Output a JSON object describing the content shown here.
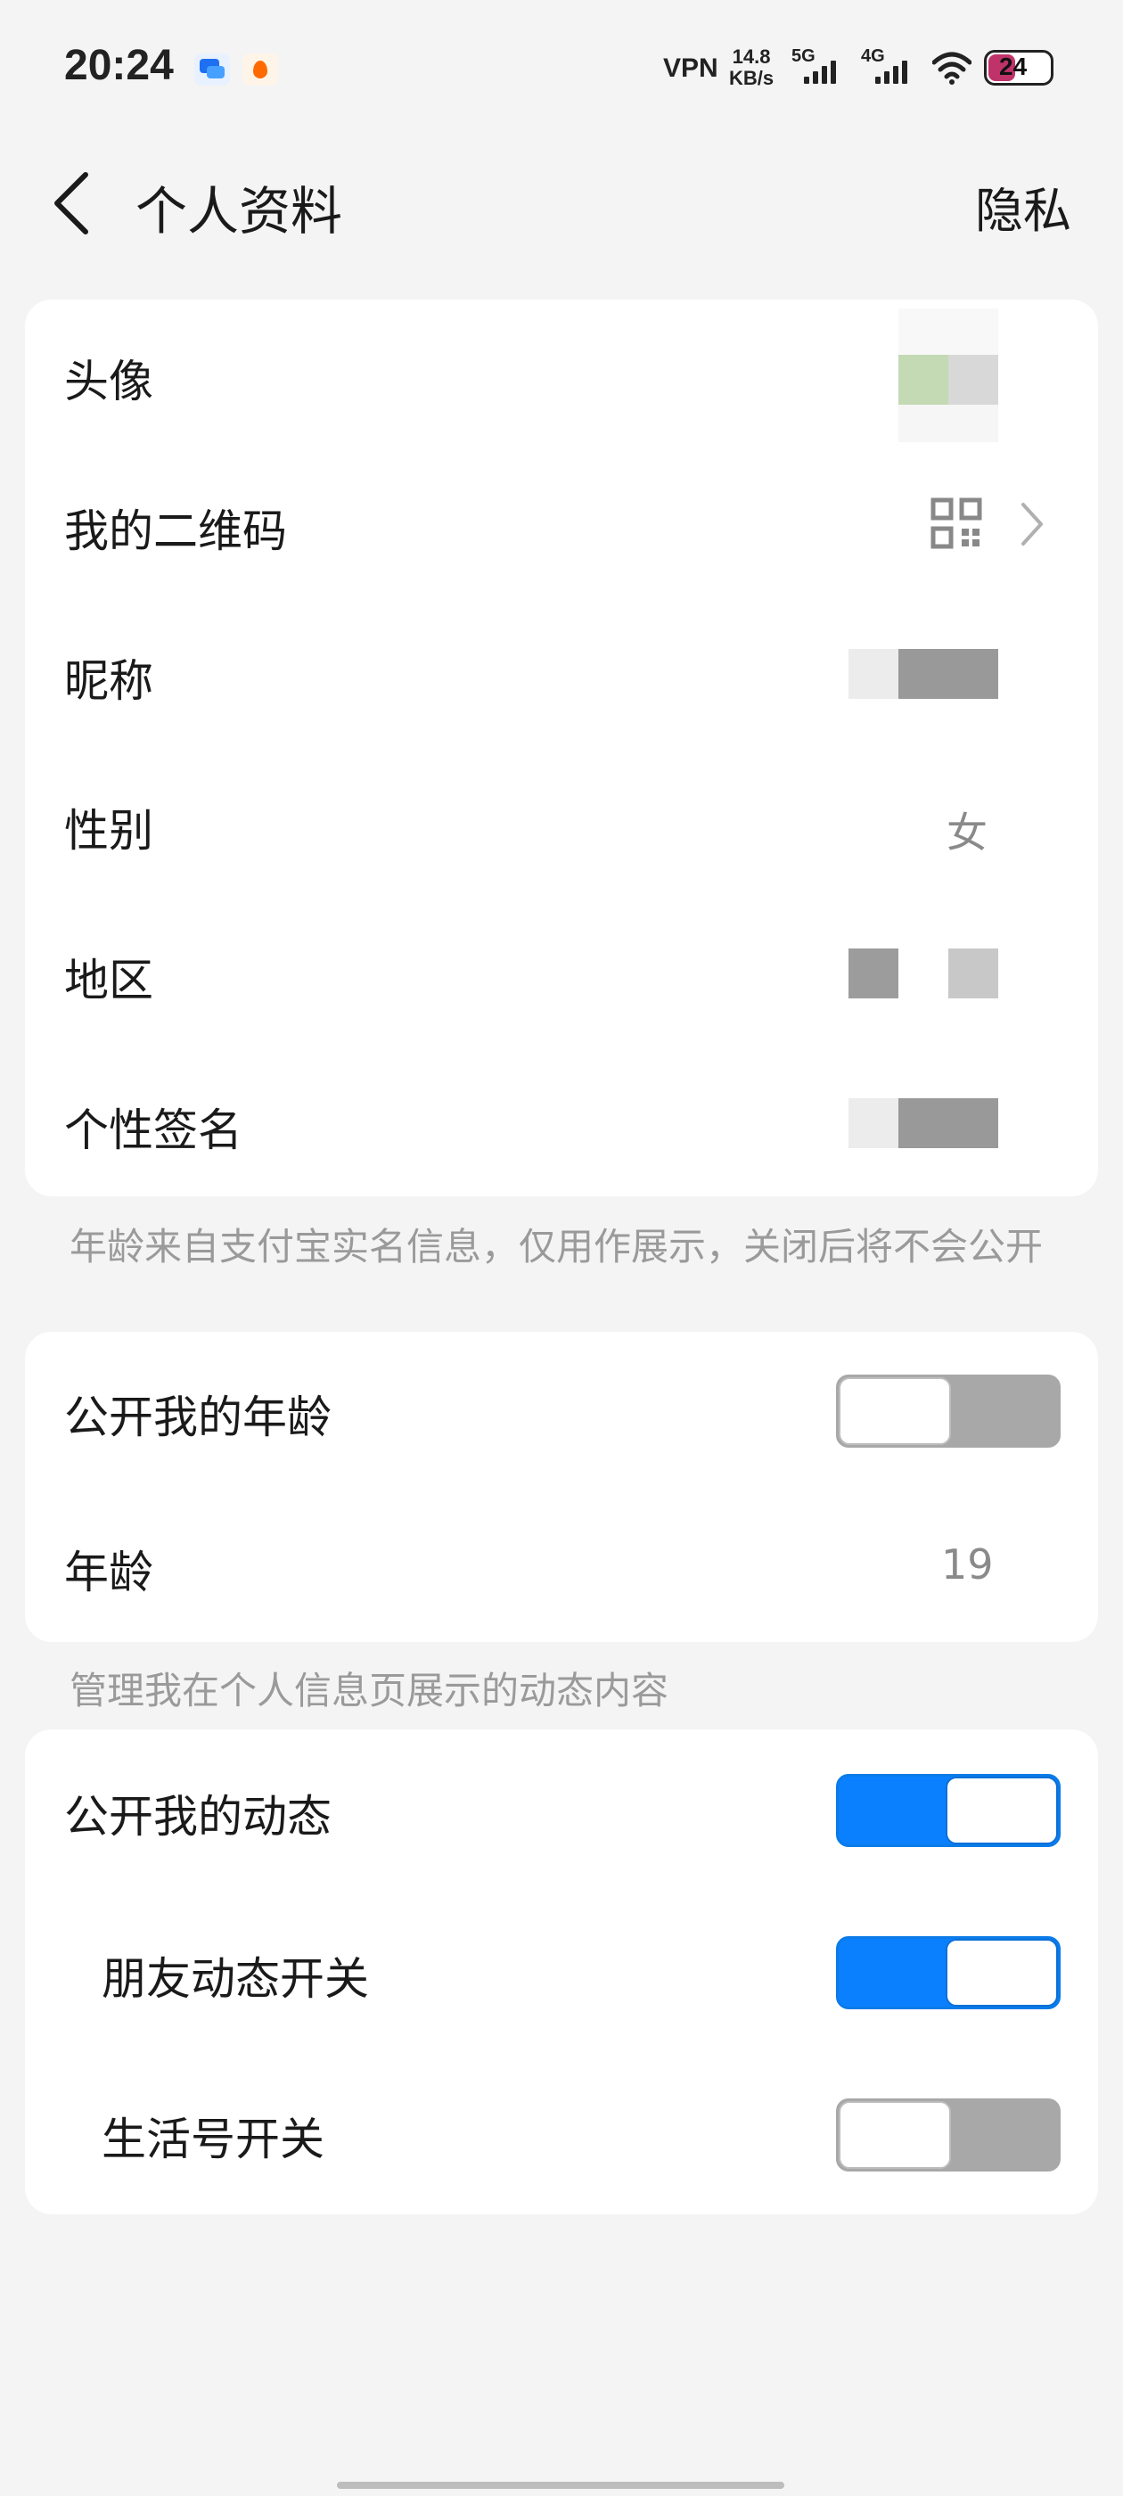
{
  "status_bar": {
    "time": "20:24",
    "vpn": "VPN",
    "speed_value": "14.8",
    "speed_unit": "KB/s",
    "net_5g": "5G",
    "net_4g": "4G",
    "battery": "24",
    "icons": [
      "chat-app-icon",
      "fire-app-icon",
      "signal-icon",
      "wifi-icon",
      "battery-icon"
    ]
  },
  "header": {
    "back_icon": "chevron-left-icon",
    "title": "个人资料",
    "privacy": "隐私"
  },
  "profile": {
    "avatar_label": "头像",
    "qrcode_label": "我的二维码",
    "qrcode_icon": "qrcode-icon",
    "nickname_label": "昵称",
    "gender_label": "性别",
    "gender_value": "女",
    "region_label": "地区",
    "signature_label": "个性签名"
  },
  "age_note": "年龄来自支付宝实名信息，仅用作展示，关闭后将不会公开",
  "age": {
    "public_age_label": "公开我的年龄",
    "public_age_on": false,
    "age_label": "年龄",
    "age_value": "19"
  },
  "moments_note": "管理我在个人信息页展示的动态内容",
  "moments": {
    "public_moments_label": "公开我的动态",
    "public_moments_on": true,
    "friends_moments_label": "朋友动态开关",
    "friends_moments_on": true,
    "life_account_label": "生活号开关",
    "life_account_on": false
  },
  "colors": {
    "accent": "#0a80ff",
    "background": "#f4f4f4",
    "card": "#ffffff",
    "toggle_off": "#a8a8a8"
  }
}
